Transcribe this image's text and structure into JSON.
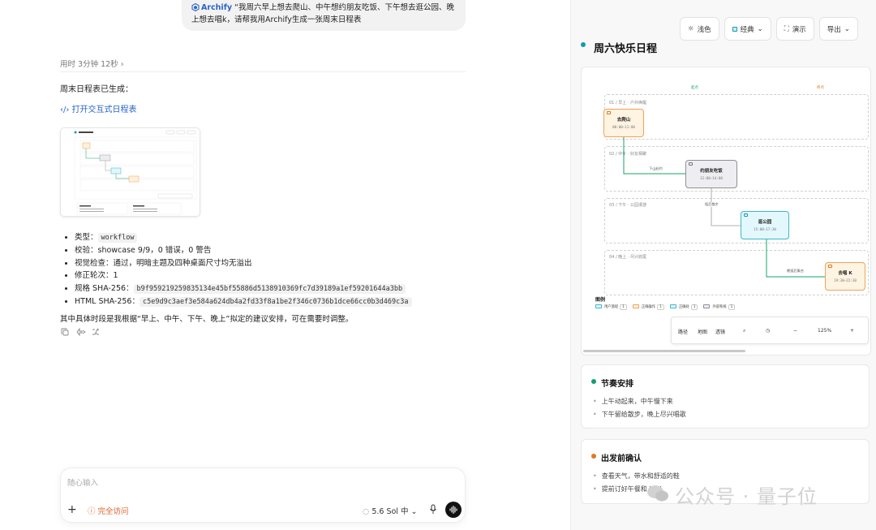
{
  "chat": {
    "user_message": {
      "app_name": "Archify",
      "text": "“我周六早上想去爬山、中午想约朋友吃饭、下午想去逛公园、晚上想去唱k，请帮我用Archify生成一张周末日程表"
    },
    "elapsed": "用时 3分钟 12秒",
    "done_text": "周末日程表已生成：",
    "open_link": "打开交互式日程表",
    "meta": [
      {
        "label": "类型：",
        "code": "workflow"
      },
      {
        "label": "校验：showcase 9/9，0 错误，0 警告"
      },
      {
        "label": "视觉检查：通过，明暗主题及四种桌面尺寸均无溢出"
      },
      {
        "label": "修正轮次：1"
      },
      {
        "label": "规格 SHA-256：",
        "code": "b9f959219259835134e45bf55886d5138910369fc7d39189a1ef59201644a3bb"
      },
      {
        "label": "HTML SHA-256：",
        "code": "c5e9d9c3aef3e584a624db4a2fd33f8a1be2f346c0736b1dce66cc0b3d469c3a"
      }
    ],
    "footnote": "其中具体时段是我根据“早上、中午、下午、晚上”拟定的建议安排，可在需要时调整。",
    "composer": {
      "placeholder": "随心输入",
      "access_label": "完全访问",
      "model_label": "5.6 Sol 中"
    }
  },
  "panel": {
    "toolbar": {
      "theme": "浅色",
      "style": "经典",
      "present": "演示",
      "export": "导出"
    },
    "title": "周六快乐日程",
    "diagram": {
      "column_heads": {
        "left": "起点",
        "right": "终点"
      },
      "lanes": [
        {
          "label": "01 / 早上 · 户外唤醒"
        },
        {
          "label": "02 / 中午 · 好友相聚"
        },
        {
          "label": "03 / 下午 · 公园漫游"
        },
        {
          "label": "04 / 晚上 · 尽兴收尾"
        }
      ],
      "nodes": [
        {
          "title": "去爬山",
          "time": "08:00–11:00"
        },
        {
          "title": "约朋友吃饭",
          "time": "12:00–14:00"
        },
        {
          "title": "逛公园",
          "time": "15:00–17:30"
        },
        {
          "title": "去唱 K",
          "time": "19:30–22:30"
        }
      ],
      "edges": [
        "下山赴约",
        "饭后散步",
        "晚饭后集合"
      ],
      "legend_title": "图例",
      "legend": [
        {
          "label": "用户旅程",
          "count": "1",
          "color": "#a9e4ef"
        },
        {
          "label": "正确操作",
          "count": "1",
          "color": "#f7c99a"
        },
        {
          "label": "正确处",
          "count": "1",
          "color": "#9fe0f0"
        },
        {
          "label": "外部系统",
          "count": "1",
          "color": "#d7d7dc"
        }
      ],
      "mini_bar": {
        "path": "路径",
        "map": "地图",
        "lens": "透镜",
        "zoom": "125%"
      }
    },
    "rhythm": {
      "title": "节奏安排",
      "items": [
        "上午动起来，中午慢下来",
        "下午留给散步，晚上尽兴唱歌"
      ],
      "dot_color": "#10a06b"
    },
    "before": {
      "title": "出发前确认",
      "items": [
        "查看天气，带水和舒适的鞋",
        "提前订好午餐和 KTV"
      ],
      "dot_color": "#e07a1f"
    }
  },
  "watermark": "公众号 · 量子位"
}
